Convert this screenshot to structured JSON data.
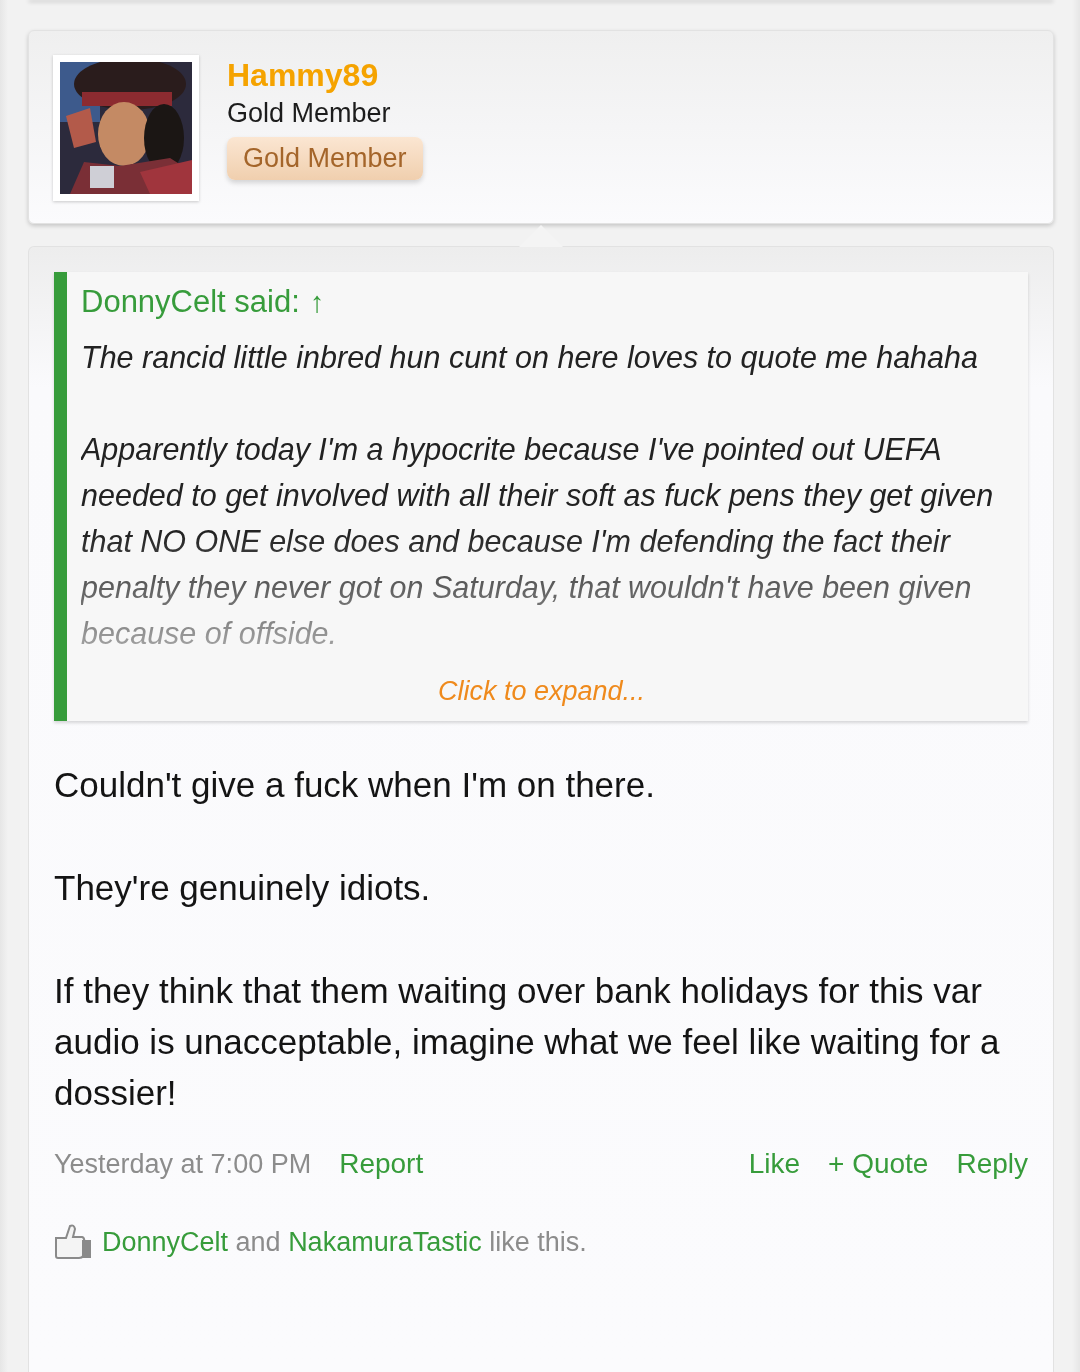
{
  "author": {
    "name": "Hammy89",
    "title": "Gold Member",
    "badge": "Gold Member"
  },
  "quote": {
    "attribution": "DonnyCelt said:",
    "jump": "↑",
    "paragraphs": [
      "The rancid little inbred hun cunt on here loves to quote me hahaha",
      "Apparently today I'm a hypocrite because I've pointed out UEFA needed to get involved with all their soft as fuck pens they get given that NO ONE else does and because I'm defending the fact their penalty they never got on Saturday, that wouldn't have been given because of offside."
    ],
    "expand": "Click to expand..."
  },
  "message": [
    "Couldn't give a fuck when I'm on there.",
    "They're genuinely idiots.",
    "If they think that them waiting over bank holidays for this var audio is unacceptable, imagine what we feel like waiting for a dossier!"
  ],
  "footer": {
    "date": "Yesterday at 7:00 PM",
    "left_links": [
      "Report"
    ],
    "right_links": [
      "Like",
      "+ Quote",
      "Reply"
    ]
  },
  "likes": {
    "names": [
      "DonnyCelt",
      "NakamuraTastic"
    ],
    "connector": "and",
    "tail": "like this."
  }
}
